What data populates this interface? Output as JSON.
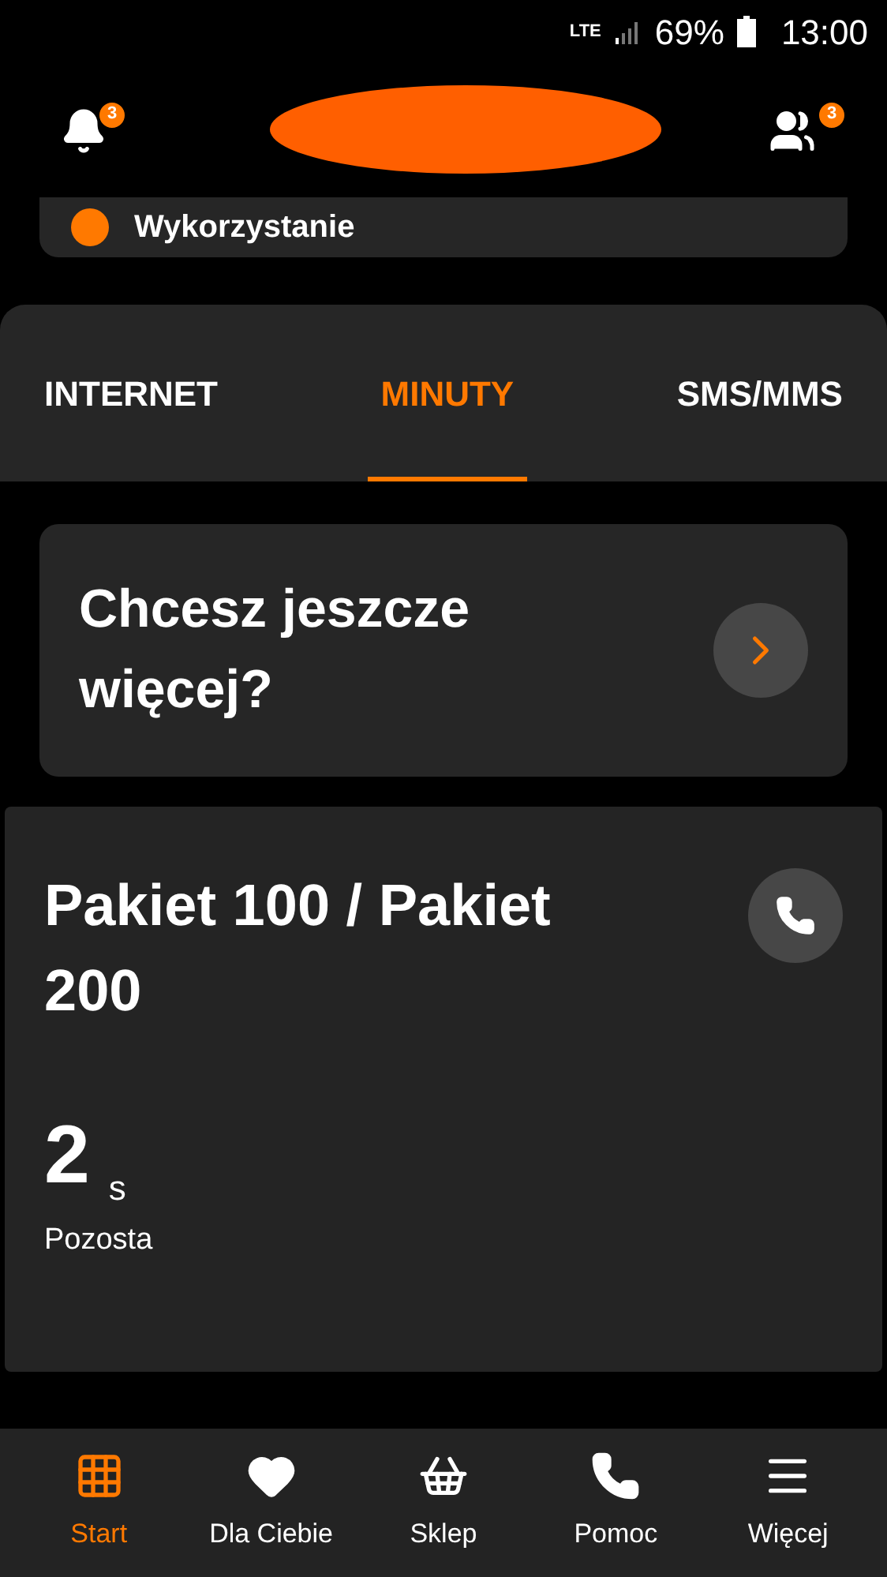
{
  "status_bar": {
    "network": "LTE",
    "battery": "69%",
    "time": "13:00"
  },
  "header": {
    "notifications_badge": "3",
    "account_badge": "3"
  },
  "usage_card": {
    "label": "Wykorzystanie"
  },
  "tabs": [
    {
      "label": "INTERNET",
      "selected": false
    },
    {
      "label": "MINUTY",
      "selected": true
    },
    {
      "label": "SMS/MMS",
      "selected": false
    }
  ],
  "promo": {
    "title": "Chcesz jeszcze więcej?"
  },
  "package": {
    "title": "Pakiet 100 / Pakiet 200",
    "amount": "2",
    "unit": "s",
    "caption": "Pozosta"
  },
  "nav": [
    {
      "kind": "grid",
      "label": "Start",
      "selected": true
    },
    {
      "kind": "heart",
      "label": "Dla Ciebie",
      "selected": false
    },
    {
      "kind": "basket",
      "label": "Sklep",
      "selected": false
    },
    {
      "kind": "phone",
      "label": "Pomoc",
      "selected": false
    },
    {
      "kind": "menu",
      "label": "Więcej",
      "selected": false
    }
  ]
}
